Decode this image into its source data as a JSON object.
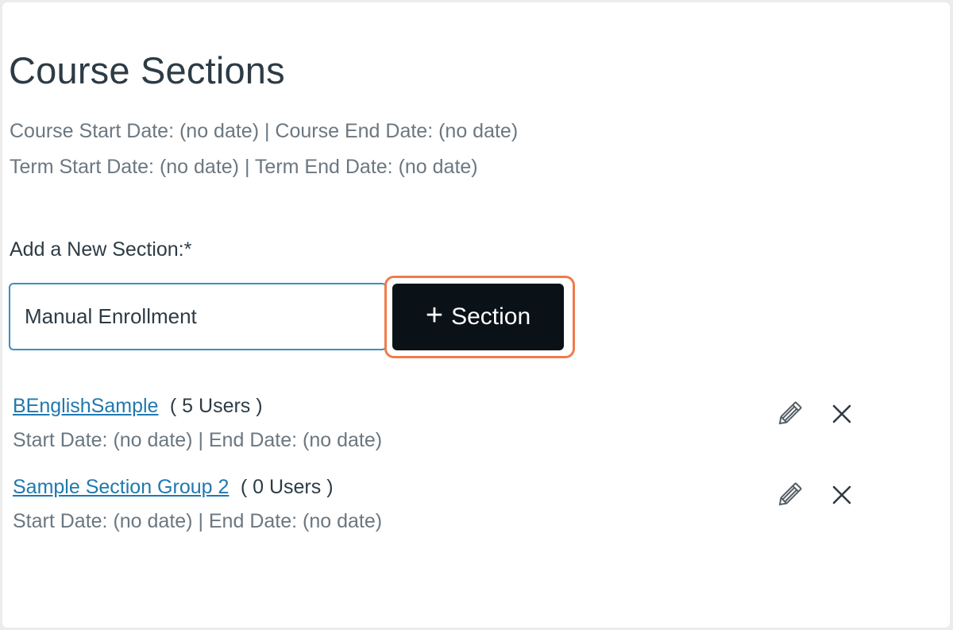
{
  "page": {
    "title": "Course Sections",
    "course_dates": "Course Start Date: (no date) | Course End Date: (no date)",
    "term_dates": "Term Start Date: (no date) | Term End Date: (no date)"
  },
  "add_section": {
    "label": "Add a New Section:*",
    "input_value": "Manual Enrollment",
    "button_label": "Section",
    "button_icon": "plus-icon"
  },
  "sections": [
    {
      "name": "BEnglishSample",
      "users": "( 5 Users )",
      "dates": "Start Date: (no date) | End Date: (no date)"
    },
    {
      "name": "Sample Section Group 2",
      "users": "( 0 Users )",
      "dates": "Start Date: (no date) | End Date: (no date)"
    }
  ],
  "colors": {
    "link": "#2079ae",
    "button_bg": "#0a1117",
    "highlight": "#f07b4a",
    "input_border": "#3d8fbf"
  }
}
